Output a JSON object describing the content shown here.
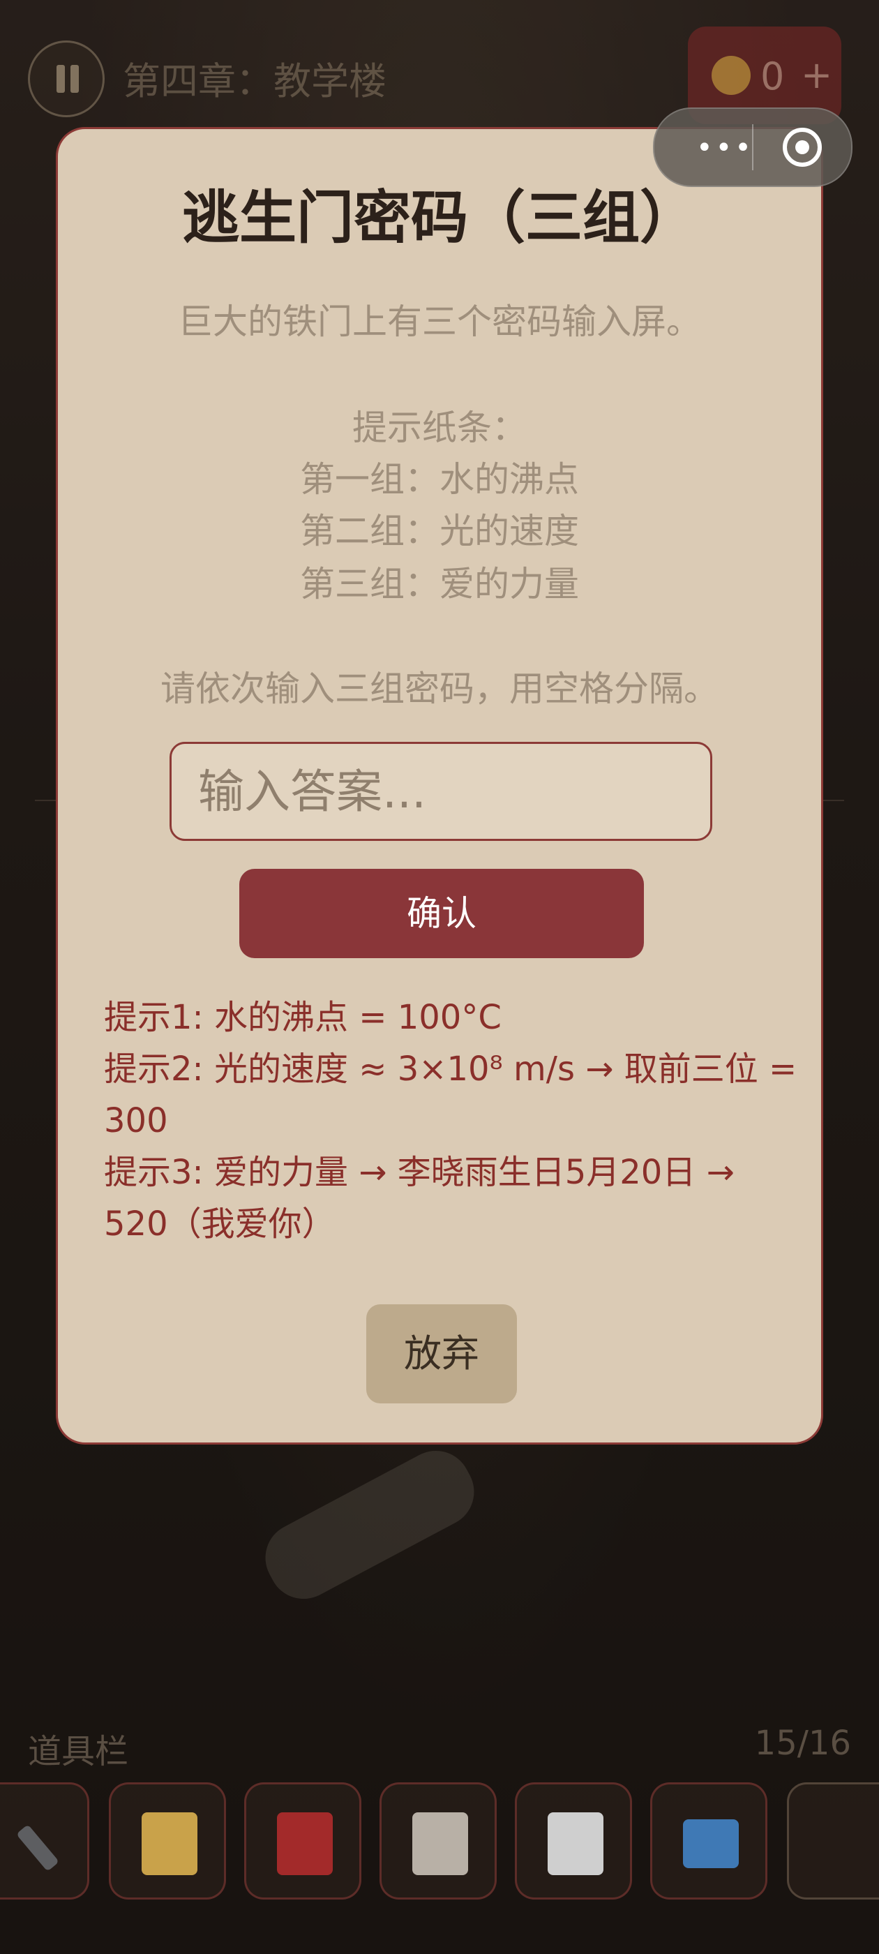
{
  "header": {
    "chapter_title": "第四章：教学楼",
    "coins": "0",
    "coin_plus": "+"
  },
  "capsule": {
    "more_label": "•••"
  },
  "modal": {
    "title": "逃生门密码（三组）",
    "description_line": "巨大的铁门上有三个密码输入屏。",
    "hint_note_title": "提示纸条：",
    "clue_1": "第一组：水的沸点",
    "clue_2": "第二组：光的速度",
    "clue_3": "第三组：爱的力量",
    "instruction": "请依次输入三组密码，用空格分隔。",
    "input_placeholder": "输入答案...",
    "confirm_label": "确认",
    "hints": [
      "提示1: 水的沸点 = 100°C",
      "提示2: 光的速度 ≈ 3×10⁸ m/s → 取前三位 = 300",
      "提示3: 爱的力量 → 李晓雨生日5月20日 → 520（我爱你）"
    ],
    "give_up_label": "放弃"
  },
  "inventory": {
    "title": "道具栏",
    "count": "15/16",
    "items": [
      {
        "icon": "wrench-icon",
        "color": "#8c96a0"
      },
      {
        "icon": "scroll-icon",
        "color": "#c9a24a"
      },
      {
        "icon": "book-icon",
        "color": "#a32a2a"
      },
      {
        "icon": "clipboard-icon",
        "color": "#b8b0a6"
      },
      {
        "icon": "memo-pencil-icon",
        "color": "#cfcfcf"
      },
      {
        "icon": "folder-icon",
        "color": "#3f79b5"
      },
      {
        "icon": "empty-slot-icon",
        "color": "#000000"
      }
    ]
  },
  "colors": {
    "modal_bg": "#dbcbb5",
    "accent": "#8a3639",
    "hint_text": "#8a2f2a"
  }
}
